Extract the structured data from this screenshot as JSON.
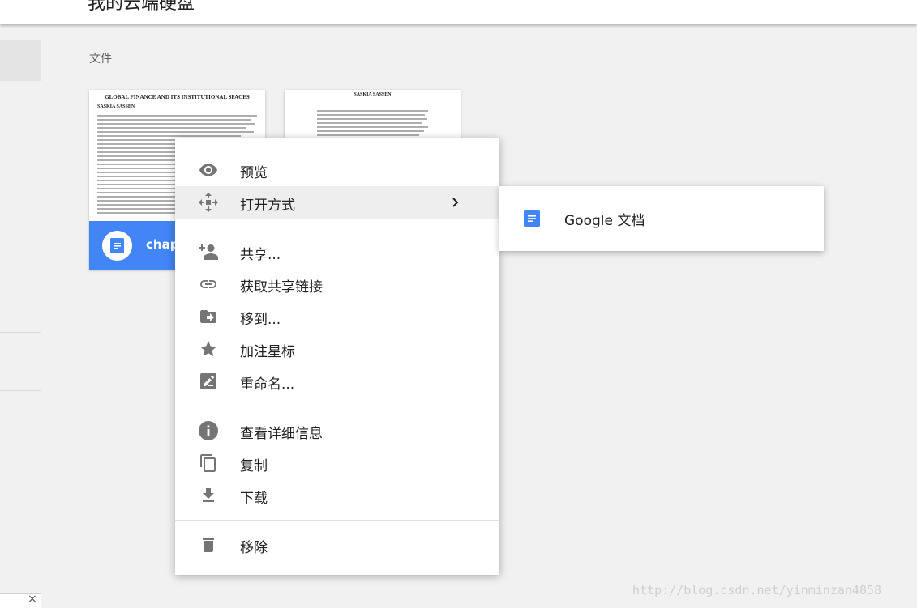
{
  "header": {
    "title": "我的云端硬盘"
  },
  "section": {
    "files_label": "文件"
  },
  "files": [
    {
      "doc_title": "GLOBAL FINANCE AND ITS INSTITUTIONAL SPACES",
      "doc_author": "SASKIA SASSEN",
      "name": "chapt"
    },
    {
      "doc_author": "SASKIA SASSEN"
    }
  ],
  "context_menu": {
    "items": [
      {
        "icon": "eye-icon",
        "label": "预览"
      },
      {
        "icon": "open-with-icon",
        "label": "打开方式"
      },
      {
        "icon": "person-add-icon",
        "label": "共享..."
      },
      {
        "icon": "link-icon",
        "label": "获取共享链接"
      },
      {
        "icon": "move-to-folder-icon",
        "label": "移到..."
      },
      {
        "icon": "star-icon",
        "label": "加注星标"
      },
      {
        "icon": "rename-icon",
        "label": "重命名..."
      },
      {
        "icon": "info-icon",
        "label": "查看详细信息"
      },
      {
        "icon": "copy-icon",
        "label": "复制"
      },
      {
        "icon": "download-icon",
        "label": "下载"
      },
      {
        "icon": "trash-icon",
        "label": "移除"
      }
    ]
  },
  "submenu": {
    "items": [
      {
        "icon": "google-docs-icon",
        "label": "Google 文档"
      }
    ]
  },
  "watermark": "http://blog.csdn.net/yinminzan4858",
  "corner": {
    "text": "",
    "close": "×"
  },
  "colors": {
    "accent": "#4285f4",
    "icon_gray": "#757575",
    "hover": "#eeeeee"
  }
}
